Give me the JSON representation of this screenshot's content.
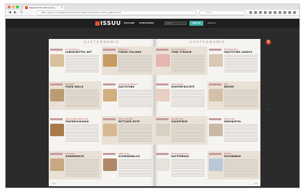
{
  "browser": {
    "tab_title": "Peppermint Anthropolog...",
    "tab_close": "×",
    "url": "https://issuu.com/peppermintanthropologie/docs/issue_6_2014_gastronomie",
    "search_placeholder": "Suche",
    "nav": {
      "back": "◀",
      "forward": "▶",
      "reload": "↻"
    }
  },
  "site": {
    "logo_prefix": "",
    "logo_accent": "■",
    "logo_text": "ISSUU",
    "nav_links": [
      "EXPLORE",
      "PUBLISHERS"
    ],
    "search_placeholder": "Search",
    "signup": "SIGN UP",
    "login": "SIGN IN",
    "close": "×"
  },
  "magazine": {
    "left_header": "GASTRONOMIE",
    "right_header": "GASTRONOMIE",
    "left_cells": [
      {
        "header": "Dr. Schnellmann",
        "title": "LEBENSMITTEL NET",
        "thumb": "#d9c09a"
      },
      {
        "header": "Mittenbruch",
        "title": "FORNO ITALIANO",
        "thumb": "#c69a63"
      },
      {
        "header": "Edelstoffe",
        "title": "FRIED WELLE",
        "thumb": "#b99c72"
      },
      {
        "header": "Gastronomie Manager",
        "title": "GASTSTUBE",
        "thumb": "#cfae80"
      },
      {
        "header": "Lebensmittel Gastronomie",
        "title": "FRIEDRICHSHAIN",
        "thumb": "#a87a4c"
      },
      {
        "header": "Brot & Salz Mitte",
        "title": "MITTLERE ROTE",
        "thumb": "#d8b890"
      },
      {
        "header": "Gastropub",
        "title": "SONNENDECK",
        "thumb": "#c7a882"
      },
      {
        "header": "Kaffee & Tee",
        "title": "SCHWENKBLICK",
        "thumb": "#b08868"
      }
    ],
    "right_cells": [
      {
        "header": "Fruchte Teeladen",
        "title": "TONE STRASSE",
        "thumb": "#e6b5b0"
      },
      {
        "header": "Markthalle Neun",
        "title": "GASTSTUBE LAUNCH",
        "thumb": "#d8c8b4"
      },
      {
        "header": "Gastro Gastro",
        "title": "WINTERFRÜCHTE",
        "thumb": "#e7cfc2"
      },
      {
        "header": "Kiez",
        "title": "BEISER",
        "thumb": "#d4c0a8"
      },
      {
        "header": "Jenseits Sushi",
        "title": "SUSHIPREIS",
        "thumb": "#d9d0c4"
      },
      {
        "header": "Weinhandel",
        "title": "DEKONSPIEL",
        "thumb": "#c9b8a6"
      },
      {
        "header": "Bäckerei Zuckerbrot",
        "title": "KAFFEEBRAU",
        "thumb": "#e6e2dc"
      },
      {
        "header": "Milchbar",
        "title": "KUCHENBAR",
        "thumb": "#b8c8d8"
      }
    ],
    "left_page_number": "102",
    "right_page_number": "103"
  }
}
